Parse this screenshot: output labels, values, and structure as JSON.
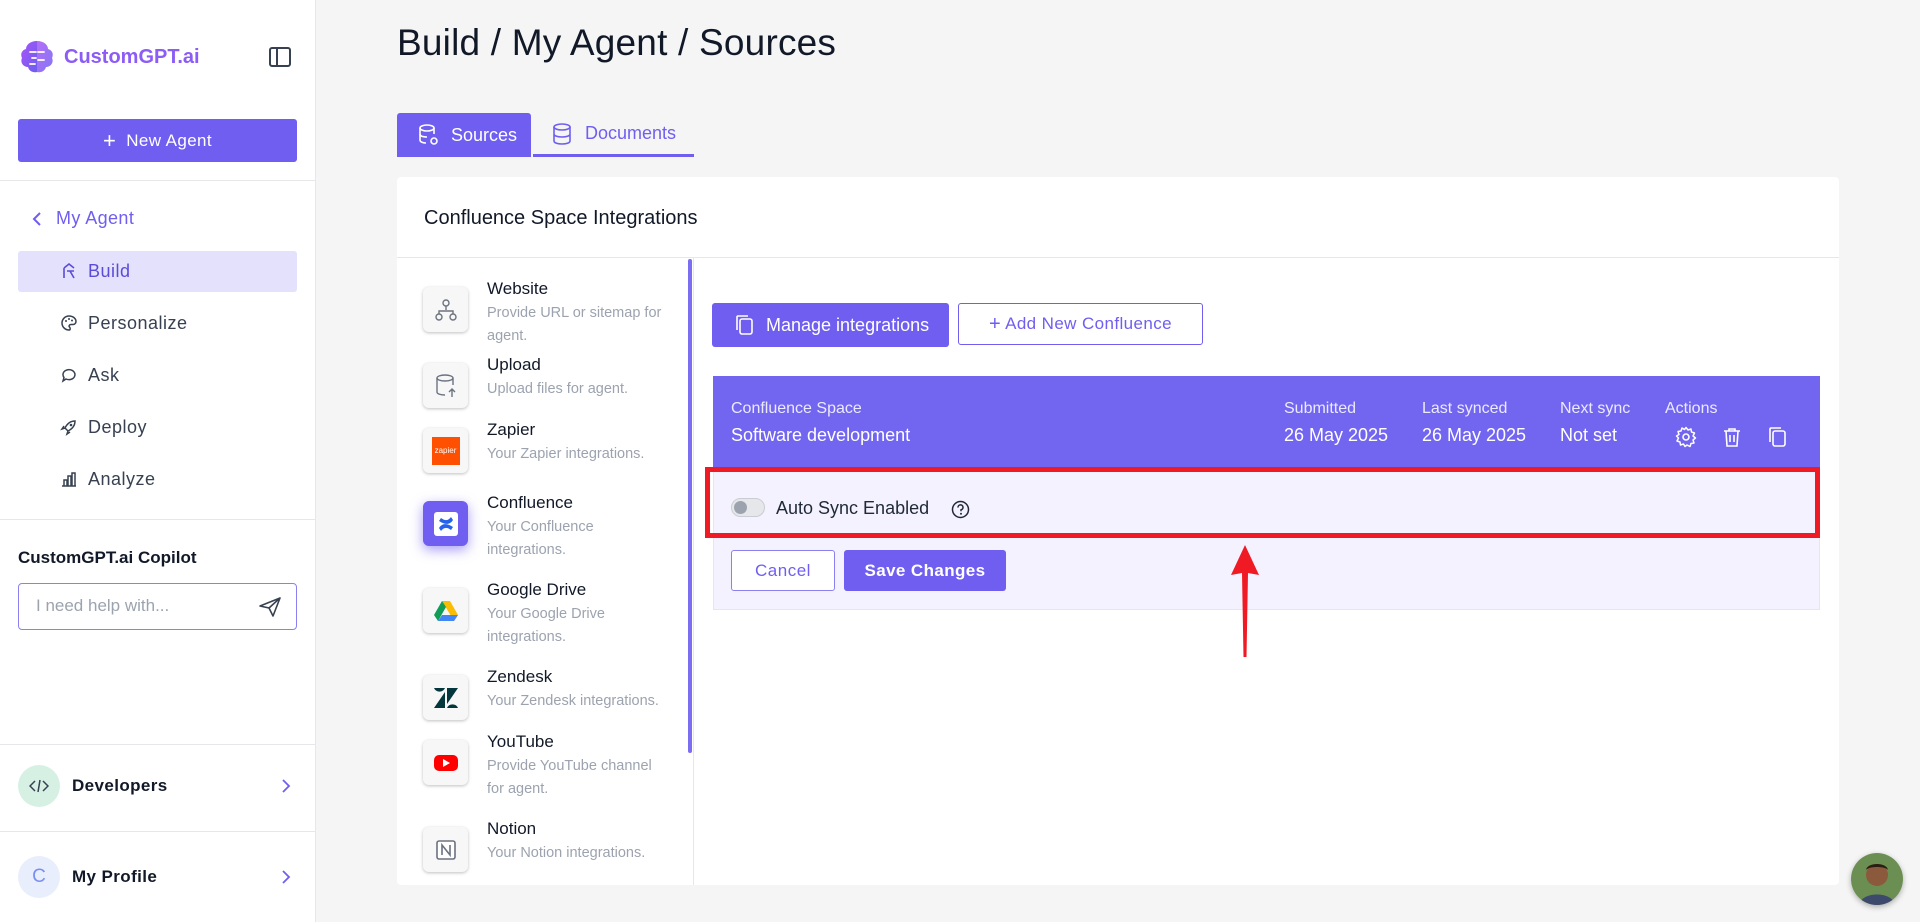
{
  "app": {
    "logo_text": "CustomGPT.ai"
  },
  "sidebar": {
    "new_agent_label": "New Agent",
    "back_label": "My Agent",
    "nav": [
      {
        "label": "Build",
        "icon": "build-icon",
        "active": true
      },
      {
        "label": "Personalize",
        "icon": "palette-icon",
        "active": false
      },
      {
        "label": "Ask",
        "icon": "chat-icon",
        "active": false
      },
      {
        "label": "Deploy",
        "icon": "rocket-icon",
        "active": false
      },
      {
        "label": "Analyze",
        "icon": "chart-icon",
        "active": false
      }
    ],
    "copilot": {
      "title": "CustomGPT.ai Copilot",
      "placeholder": "I need help with..."
    },
    "developers_label": "Developers",
    "profile_label": "My Profile",
    "profile_initial": "C"
  },
  "main": {
    "title": "Build / My Agent / Sources",
    "tabs": [
      {
        "label": "Sources",
        "active": true
      },
      {
        "label": "Documents",
        "active": false
      }
    ],
    "panel_title": "Confluence Space Integrations",
    "sources": [
      {
        "name": "Website",
        "desc": "Provide URL or sitemap for agent."
      },
      {
        "name": "Upload",
        "desc": "Upload files for agent."
      },
      {
        "name": "Zapier",
        "desc": "Your Zapier integrations.",
        "icon_text": "zapier"
      },
      {
        "name": "Confluence",
        "desc": "Your Confluence integrations."
      },
      {
        "name": "Google Drive",
        "desc": "Your Google Drive integrations."
      },
      {
        "name": "Zendesk",
        "desc": "Your Zendesk integrations."
      },
      {
        "name": "YouTube",
        "desc": "Provide YouTube channel for agent."
      },
      {
        "name": "Notion",
        "desc": "Your Notion integrations."
      }
    ],
    "manage_label": "Manage integrations",
    "add_label": "Add New Confluence",
    "table": {
      "headers": {
        "space": "Confluence Space",
        "submitted": "Submitted",
        "last_synced": "Last synced",
        "next_sync": "Next sync",
        "actions": "Actions"
      },
      "row": {
        "space": "Software development",
        "submitted": "26 May 2025",
        "last_synced": "26 May 2025",
        "next_sync": "Not set"
      }
    },
    "auto_sync_label": "Auto Sync Enabled",
    "auto_sync_on": false,
    "cancel_label": "Cancel",
    "save_label": "Save Changes"
  },
  "colors": {
    "accent": "#6f5ef0",
    "highlight": "#f01a24"
  }
}
